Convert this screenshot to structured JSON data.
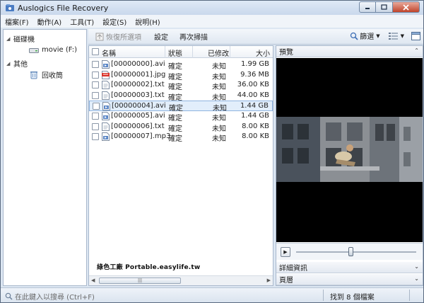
{
  "window": {
    "title": "Auslogics File Recovery"
  },
  "menu": [
    "檔案(F)",
    "動作(A)",
    "工具(T)",
    "設定(S)",
    "說明(H)"
  ],
  "sidebar": {
    "groups": [
      {
        "label": "磁碟機",
        "children": [
          {
            "label": "movie (F:)"
          }
        ]
      },
      {
        "label": "其他",
        "children": [
          {
            "label": "回收筒"
          }
        ]
      }
    ]
  },
  "toolbar": {
    "restore_label": "恢復所選項",
    "settings_label": "設定",
    "rescan_label": "再次掃描",
    "filter_label": "篩選"
  },
  "list": {
    "columns": {
      "name": "名稱",
      "status": "狀態",
      "modified": "已修改",
      "size": "大小"
    },
    "rows": [
      {
        "name": "[00000000].avi",
        "status": "確定",
        "modified": "未知",
        "size": "1.99 GB",
        "type": "video",
        "selected": false
      },
      {
        "name": "[00000001].jpg",
        "status": "確定",
        "modified": "未知",
        "size": "9.36 MB",
        "type": "image",
        "selected": false
      },
      {
        "name": "[00000002].txt",
        "status": "確定",
        "modified": "未知",
        "size": "36.00 KB",
        "type": "text",
        "selected": false
      },
      {
        "name": "[00000003].txt",
        "status": "確定",
        "modified": "未知",
        "size": "44.00 KB",
        "type": "text",
        "selected": false
      },
      {
        "name": "[00000004].avi",
        "status": "確定",
        "modified": "未知",
        "size": "1.44 GB",
        "type": "video",
        "selected": true
      },
      {
        "name": "[00000005].avi",
        "status": "確定",
        "modified": "未知",
        "size": "1.44 GB",
        "type": "video",
        "selected": false
      },
      {
        "name": "[00000006].txt",
        "status": "確定",
        "modified": "未知",
        "size": "8.00 KB",
        "type": "text",
        "selected": false
      },
      {
        "name": "[00000007].mp3",
        "status": "確定",
        "modified": "未知",
        "size": "8.00 KB",
        "type": "video",
        "selected": false
      }
    ]
  },
  "preview": {
    "title": "預覽",
    "details_title": "詳細資訊",
    "pages_title": "頁層",
    "seek_fraction": 0.46
  },
  "watermark": "綠色工廠 Portable.easylife.tw",
  "status": {
    "search_placeholder": "在此鍵入以搜尋 (Ctrl+F)",
    "count": "找到 8 個檔案"
  },
  "colors": {
    "accent": "#3b6db5",
    "selection": "#e2eefb",
    "close": "#c0442b"
  }
}
